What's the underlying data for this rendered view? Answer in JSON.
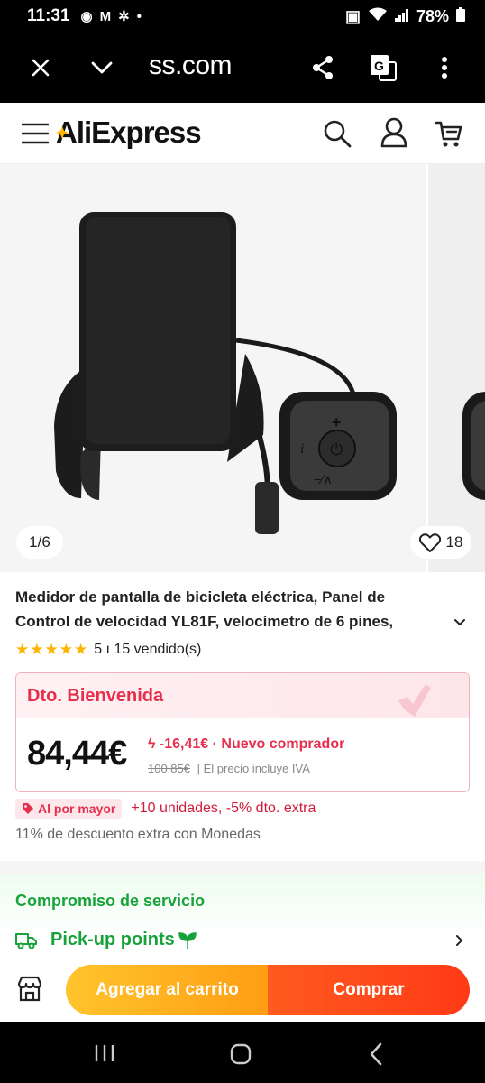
{
  "status_bar": {
    "time": "11:31",
    "battery": "78%"
  },
  "browser": {
    "url": "ss.com"
  },
  "header": {
    "logo_prefix": "Ali",
    "logo_suffix": "Express"
  },
  "gallery": {
    "counter": "1/6",
    "likes": "18"
  },
  "product": {
    "title": "Medidor de pantalla de bicicleta eléctrica, Panel de Control de velocidad YL81F, velocímetro de 6 pines,",
    "rating_stars": 5,
    "rating_text": "5 ı 15 vendido(s)"
  },
  "promo": {
    "header": "Dto. Bienvenida",
    "price": "84,44€",
    "discount": "-16,41€ · Nuevo comprador",
    "original_price": "100,85€",
    "tax_note": "| El precio incluye IVA"
  },
  "bulk": {
    "badge": "Al por mayor",
    "text": "+10 unidades, -5% dto. extra"
  },
  "coins_text": "11% de descuento extra con Monedas",
  "service": {
    "title": "Compromiso de servicio",
    "pickup": "Pick-up points"
  },
  "actions": {
    "add_to_cart": "Agregar al carrito",
    "buy": "Comprar"
  },
  "colors": {
    "accent_red": "#e62e4d",
    "green": "#18a33a",
    "cart_orange": "#ff9d14",
    "buy_red": "#ff3a16"
  }
}
